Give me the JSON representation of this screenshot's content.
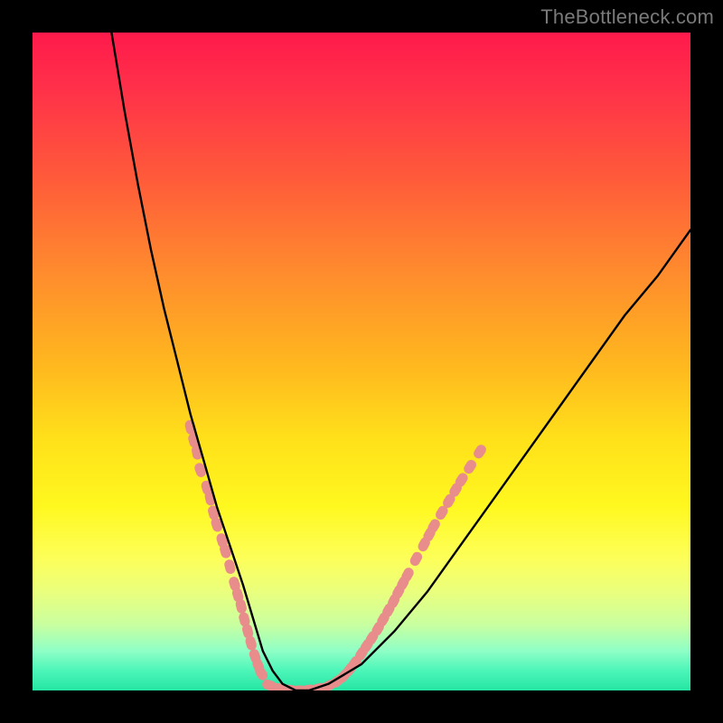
{
  "watermark": {
    "text": "TheBottleneck.com"
  },
  "chart_data": {
    "type": "line",
    "title": "",
    "xlabel": "",
    "ylabel": "",
    "xlim": [
      0,
      100
    ],
    "ylim": [
      0,
      100
    ],
    "series": [
      {
        "name": "bottleneck-curve",
        "x": [
          12,
          14,
          16,
          18,
          20,
          22,
          24,
          26,
          28,
          30,
          32,
          33.5,
          35,
          36.5,
          38,
          40,
          42,
          45,
          50,
          55,
          60,
          65,
          70,
          75,
          80,
          85,
          90,
          95,
          100
        ],
        "y": [
          100,
          88,
          77,
          67,
          58,
          50,
          42,
          35,
          28,
          22,
          16,
          11,
          6,
          3,
          1,
          0,
          0,
          1,
          4,
          9,
          15,
          22,
          29,
          36,
          43,
          50,
          57,
          63,
          70
        ]
      }
    ],
    "markers": [
      {
        "name": "highlight-dots",
        "color": "#e88d8b",
        "points": [
          [
            24,
            40
          ],
          [
            24.5,
            38
          ],
          [
            25,
            36.2
          ],
          [
            25.5,
            33.5
          ],
          [
            26.5,
            30.8
          ],
          [
            27,
            29.2
          ],
          [
            27.5,
            27
          ],
          [
            28,
            25.2
          ],
          [
            28.8,
            22.8
          ],
          [
            29.3,
            21.2
          ],
          [
            30,
            18.8
          ],
          [
            30.7,
            16.2
          ],
          [
            31.2,
            14.5
          ],
          [
            31.7,
            12.8
          ],
          [
            32.2,
            10.8
          ],
          [
            32.7,
            9
          ],
          [
            33.2,
            7.2
          ],
          [
            33.8,
            5.2
          ],
          [
            34.3,
            3.8
          ],
          [
            34.8,
            2.6
          ],
          [
            36,
            0.8
          ],
          [
            37.5,
            0.3
          ],
          [
            39,
            0.1
          ],
          [
            40.5,
            0
          ],
          [
            42,
            0.1
          ],
          [
            43.5,
            0.3
          ],
          [
            45,
            0.7
          ],
          [
            46.3,
            1.4
          ],
          [
            47.3,
            2.2
          ],
          [
            48.2,
            3.2
          ],
          [
            49,
            4.2
          ],
          [
            50,
            5.6
          ],
          [
            50.8,
            6.8
          ],
          [
            51.6,
            8
          ],
          [
            52.5,
            9.4
          ],
          [
            53.3,
            10.8
          ],
          [
            54.1,
            12.2
          ],
          [
            54.9,
            13.6
          ],
          [
            55.6,
            15
          ],
          [
            56.3,
            16.3
          ],
          [
            57,
            17.6
          ],
          [
            58.3,
            20
          ],
          [
            59.5,
            22.2
          ],
          [
            60.3,
            23.7
          ],
          [
            61,
            25
          ],
          [
            62.2,
            27
          ],
          [
            63.3,
            28.8
          ],
          [
            64.3,
            30.5
          ],
          [
            65.2,
            32
          ],
          [
            66.5,
            34
          ],
          [
            68,
            36.3
          ]
        ]
      }
    ],
    "background_gradient": {
      "stops": [
        [
          "#ff1a4b",
          0
        ],
        [
          "#ff5a3a",
          22
        ],
        [
          "#ffb61f",
          50
        ],
        [
          "#fff81f",
          72
        ],
        [
          "#c9ffa0",
          90
        ],
        [
          "#25e6a3",
          100
        ]
      ]
    }
  }
}
